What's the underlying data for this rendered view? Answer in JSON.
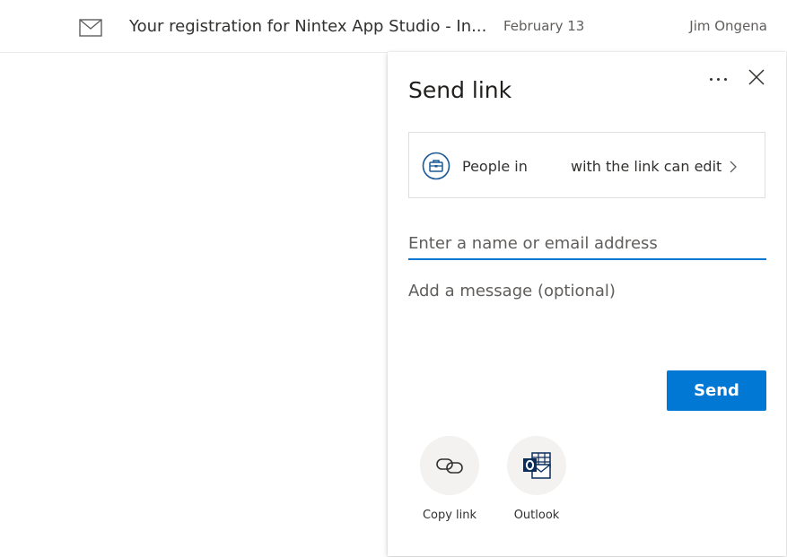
{
  "email": {
    "subject": "Your registration for Nintex App Studio - In...",
    "date": "February 13",
    "sender": "Jim Ongena"
  },
  "dialog": {
    "title": "Send link",
    "permission": {
      "prefix": "People in",
      "suffix": "with the link can edit"
    },
    "to_placeholder": "Enter a name or email address",
    "message_placeholder": "Add a message (optional)",
    "send_label": "Send",
    "share_options": [
      {
        "label": "Copy link",
        "icon": "link-icon"
      },
      {
        "label": "Outlook",
        "icon": "outlook-icon"
      }
    ]
  },
  "colors": {
    "accent": "#0078d4",
    "permission_icon": "#1b5a96",
    "outlook": "#0a2e5c"
  }
}
